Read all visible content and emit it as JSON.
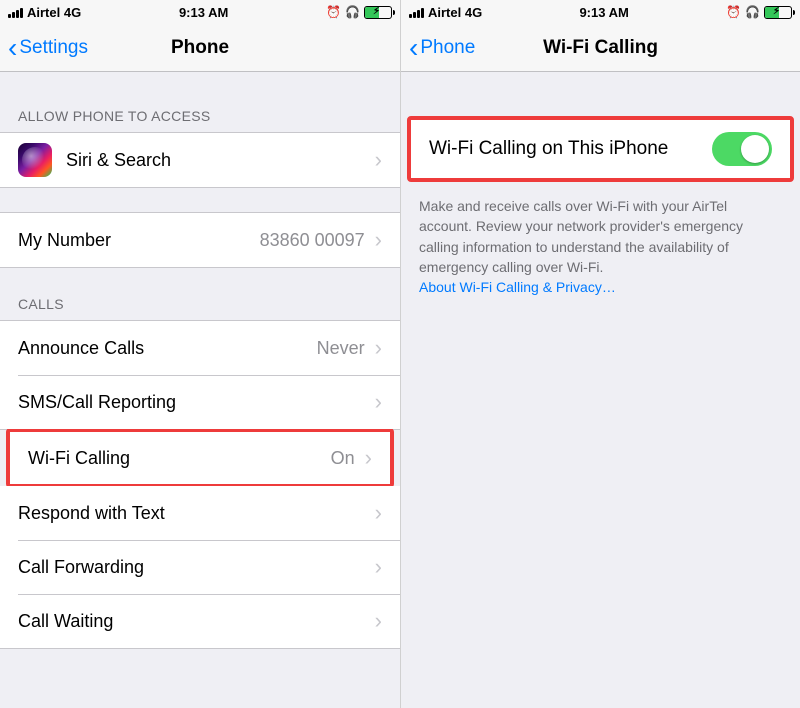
{
  "status": {
    "carrier": "Airtel 4G",
    "time": "9:13 AM"
  },
  "left": {
    "nav": {
      "back": "Settings",
      "title": "Phone"
    },
    "section_access": "ALLOW PHONE TO ACCESS",
    "siri_label": "Siri & Search",
    "my_number": {
      "label": "My Number",
      "value": "83860 00097"
    },
    "section_calls": "CALLS",
    "rows": {
      "announce": {
        "label": "Announce Calls",
        "value": "Never"
      },
      "sms": {
        "label": "SMS/Call Reporting"
      },
      "wifi": {
        "label": "Wi-Fi Calling",
        "value": "On"
      },
      "respond": {
        "label": "Respond with Text"
      },
      "forward": {
        "label": "Call Forwarding"
      },
      "waiting": {
        "label": "Call Waiting"
      }
    }
  },
  "right": {
    "nav": {
      "back": "Phone",
      "title": "Wi-Fi Calling"
    },
    "toggle_label": "Wi-Fi Calling on This iPhone",
    "toggle_on": true,
    "footer_text": "Make and receive calls over Wi-Fi with your AirTel account. Review your network provider's emergency calling information to understand the availability of emergency calling over Wi-Fi.",
    "footer_link": "About Wi-Fi Calling & Privacy…"
  }
}
